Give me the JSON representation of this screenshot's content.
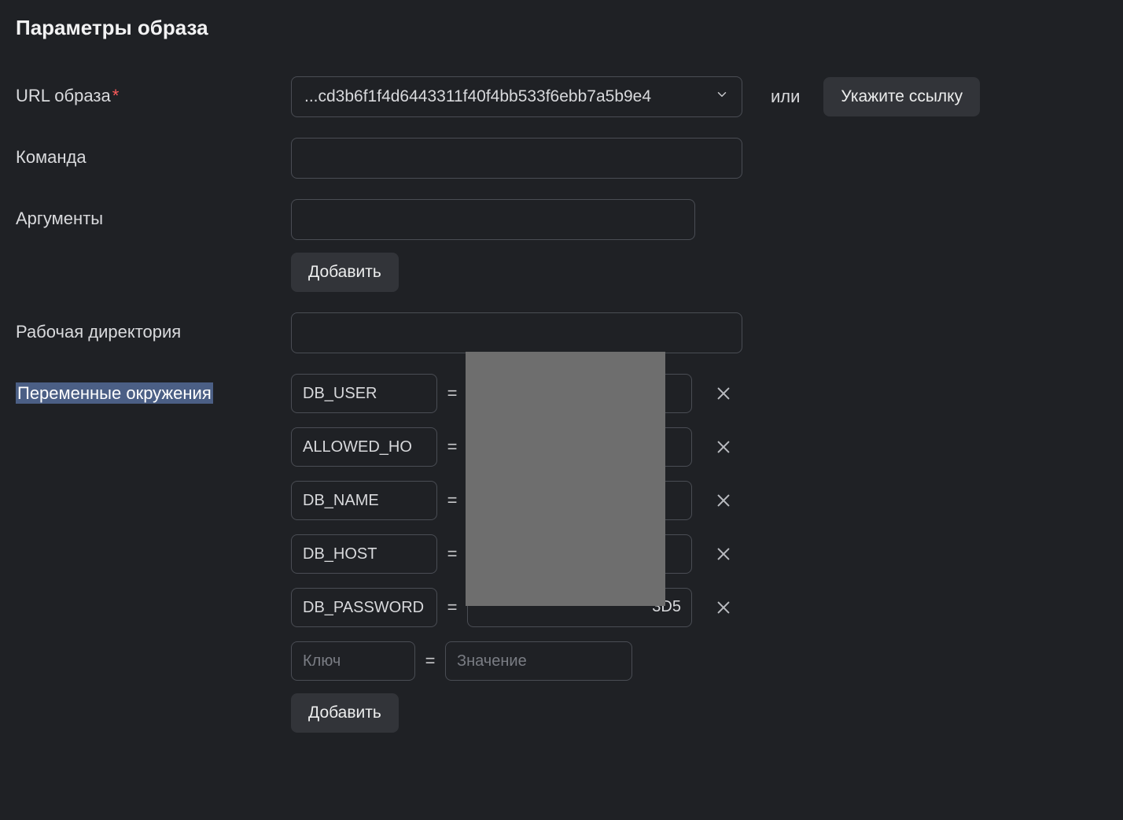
{
  "section": {
    "title": "Параметры образа"
  },
  "imageUrl": {
    "label": "URL образа",
    "required": "*",
    "selected": "...cd3b6f1f4d6443311f40f4bb533f6ebb7a5b9e4",
    "orText": "или",
    "linkButton": "Укажите ссылку"
  },
  "command": {
    "label": "Команда",
    "value": ""
  },
  "arguments": {
    "label": "Аргументы",
    "value": "",
    "addButton": "Добавить"
  },
  "workdir": {
    "label": "Рабочая директория",
    "value": ""
  },
  "env": {
    "label": "Переменные окружения",
    "eq": "=",
    "rows": [
      {
        "key": "DB_USER",
        "value": ""
      },
      {
        "key": "ALLOWED_HO",
        "value": ""
      },
      {
        "key": "DB_NAME",
        "value": ""
      },
      {
        "key": "DB_HOST",
        "value": ""
      },
      {
        "key": "DB_PASSWORD",
        "valueTail": "3D5"
      }
    ],
    "newRow": {
      "keyPlaceholder": "Ключ",
      "valuePlaceholder": "Значение"
    },
    "addButton": "Добавить"
  }
}
